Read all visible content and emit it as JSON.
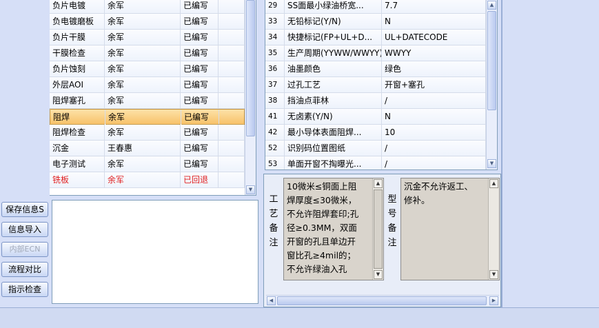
{
  "process_grid": {
    "rows": [
      {
        "process": "负片电镀",
        "operator": "余军",
        "status": "已编写",
        "returned": false
      },
      {
        "process": "负电镀磨板",
        "operator": "余军",
        "status": "已编写",
        "returned": false
      },
      {
        "process": "负片干膜",
        "operator": "余军",
        "status": "已编写",
        "returned": false
      },
      {
        "process": "干膜检查",
        "operator": "余军",
        "status": "已编写",
        "returned": false
      },
      {
        "process": "负片蚀刻",
        "operator": "余军",
        "status": "已编写",
        "returned": false
      },
      {
        "process": "外层AOI",
        "operator": "余军",
        "status": "已编写",
        "returned": false
      },
      {
        "process": "阻焊塞孔",
        "operator": "余军",
        "status": "已编写",
        "returned": false
      },
      {
        "process": "阻焊",
        "operator": "余军",
        "status": "已编写",
        "returned": false,
        "selected": true
      },
      {
        "process": "阻焊检查",
        "operator": "余军",
        "status": "已编写",
        "returned": false
      },
      {
        "process": "沉金",
        "operator": "王春惠",
        "status": "已编写",
        "returned": false
      },
      {
        "process": "电子测试",
        "operator": "余军",
        "status": "已编写",
        "returned": false
      },
      {
        "process": "铣板",
        "operator": "余军",
        "status": "已回退",
        "returned": true
      }
    ]
  },
  "side_buttons": {
    "save": "保存信息S",
    "import": "信息导入",
    "internal_ecn": "内部ECN",
    "flow_compare": "流程对比",
    "instruction_check": "指示检查"
  },
  "spec_grid": {
    "rows": [
      {
        "no": "29",
        "name": "SS面最小绿油桥宽...",
        "value": "7.7"
      },
      {
        "no": "33",
        "name": "无铅标记(Y/N)",
        "value": "N"
      },
      {
        "no": "34",
        "name": "快捷标记(FP+UL+D...",
        "value": "UL+DATECODE"
      },
      {
        "no": "35",
        "name": "生产周期(YYWW/WWYY)",
        "value": "WWYY"
      },
      {
        "no": "36",
        "name": "油墨颜色",
        "value": "绿色"
      },
      {
        "no": "37",
        "name": "过孔工艺",
        "value": "开窗+塞孔"
      },
      {
        "no": "38",
        "name": "挡油点菲林",
        "value": "/"
      },
      {
        "no": "41",
        "name": "无卤素(Y/N)",
        "value": "N"
      },
      {
        "no": "42",
        "name": "最小导体表面阻焊...",
        "value": "10"
      },
      {
        "no": "52",
        "name": "识别码位置图纸",
        "value": "/"
      },
      {
        "no": "53",
        "name": "单面开窗不掏曝光...",
        "value": "/"
      }
    ]
  },
  "remarks": {
    "process_label": [
      "工",
      "艺",
      "备",
      "注"
    ],
    "process_remark_lines": [
      "10微米≤铜面上阻",
      "焊厚度≤30微米，",
      "不允许阻焊套印;孔",
      "径≥0.3MM，双面",
      "开窗的孔且单边开",
      "窗比孔≥4mil的；",
      "不允许绿油入孔"
    ],
    "model_label": [
      "型",
      "号",
      "备",
      "注"
    ],
    "model_remark_lines": [
      "沉金不允许返工、",
      "修补。"
    ]
  },
  "colors": {
    "background": "#d6dff7",
    "selected_row": "#f7c26a",
    "returned_text": "#e02020",
    "memo_background": "#d9d4cc"
  }
}
